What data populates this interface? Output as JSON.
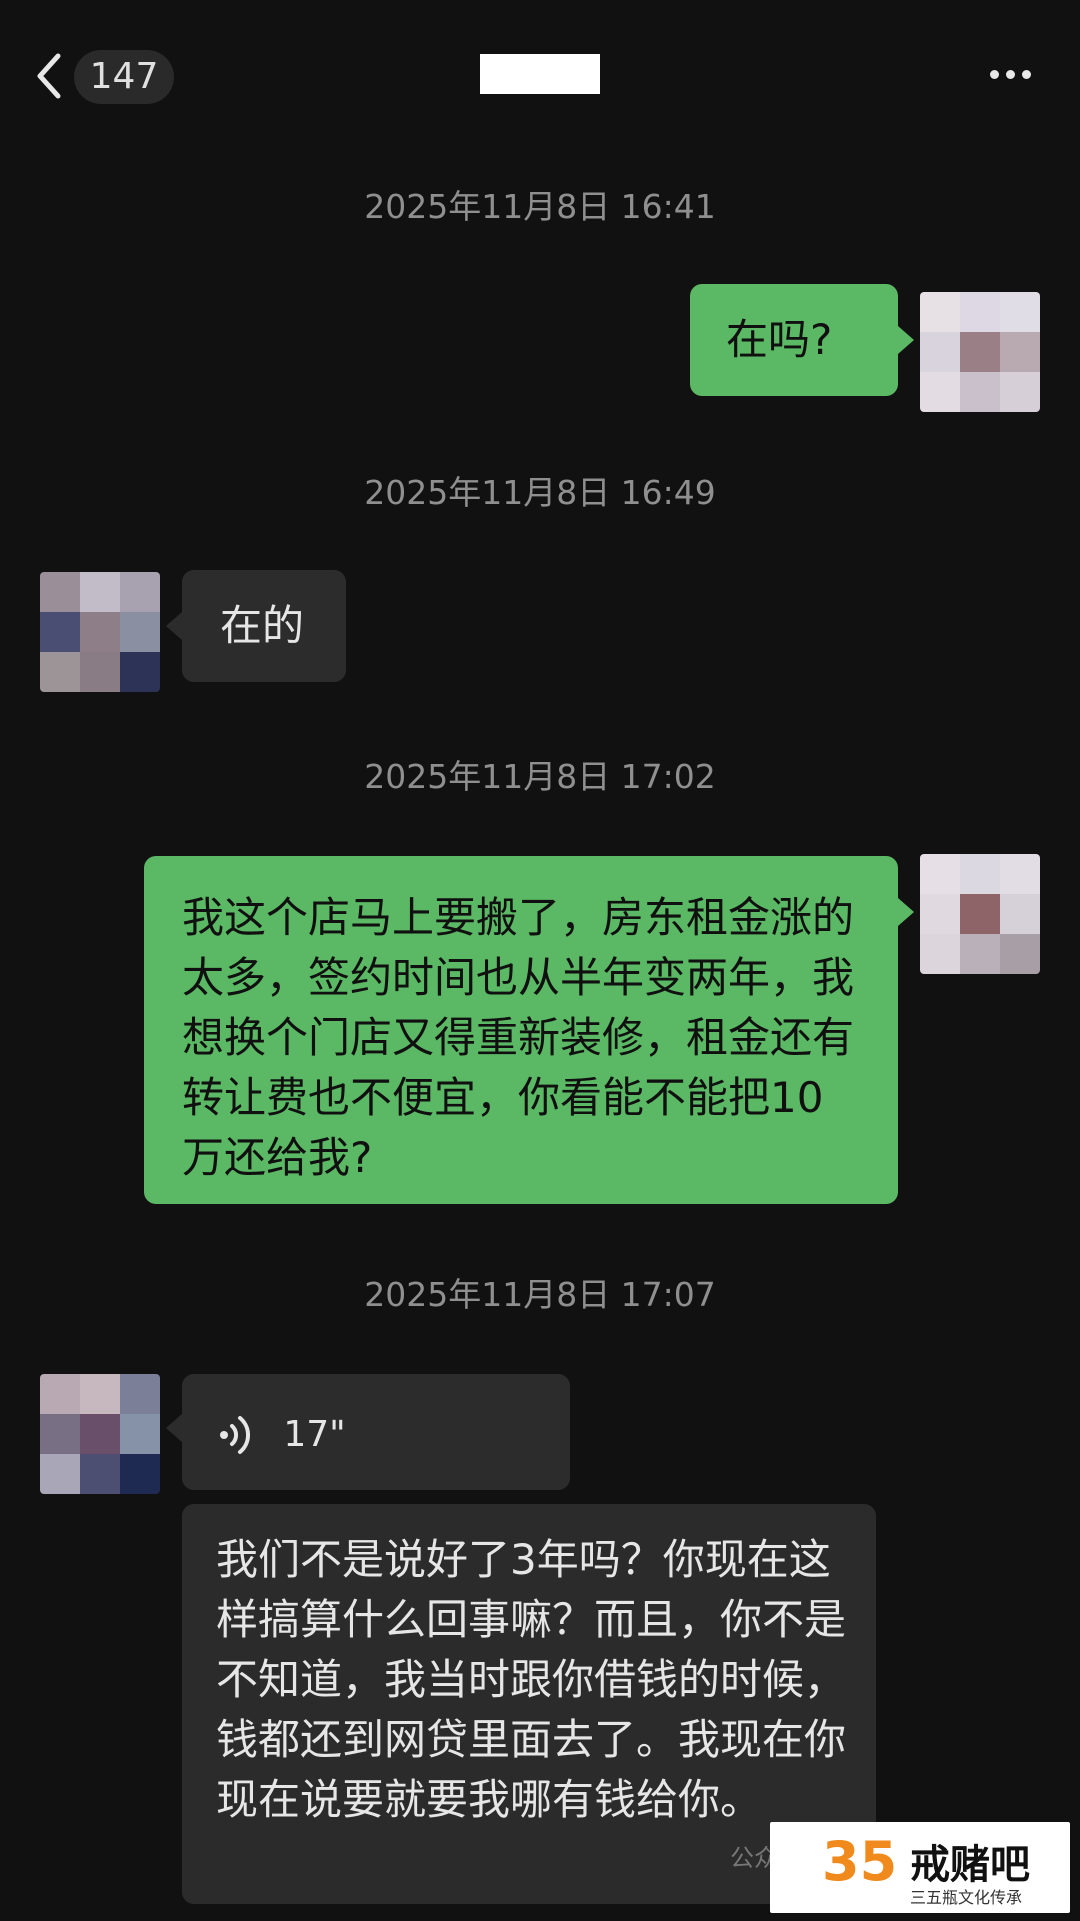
{
  "header": {
    "back_count": "147"
  },
  "messages": {
    "ts1": "2025年11月8日 16:41",
    "m1": "在吗?",
    "ts2": "2025年11月8日 16:49",
    "m2": "在的",
    "ts3": "2025年11月8日 17:02",
    "m3": "我这个店马上要搬了，房东租金涨的太多，签约时间也从半年变两年，我想换个门店又得重新装修，租金还有转让费也不便宜，你看能不能把10万还给我?",
    "ts4": "2025年11月8日 17:07",
    "voice_duration": "17\"",
    "voice_transcript": "我们不是说好了3年吗？你现在这样搞算什么回事嘛？而且，你不是不知道，我当时跟你借钱的时候，钱都还到网贷里面去了。我现在你现在说要就要我哪有钱给你。"
  },
  "watermark": {
    "logo_num": "35",
    "name": "戒赌吧",
    "sub": "三五瓶文化传承",
    "prefix": "公众号"
  },
  "colors": {
    "background": "#111111",
    "outgoing_bubble": "#5bb864",
    "incoming_bubble": "#2c2c2c",
    "timestamp": "#8f8f8f"
  },
  "icons": [
    "back-chevron-icon",
    "more-dots-icon",
    "voice-wave-icon"
  ]
}
